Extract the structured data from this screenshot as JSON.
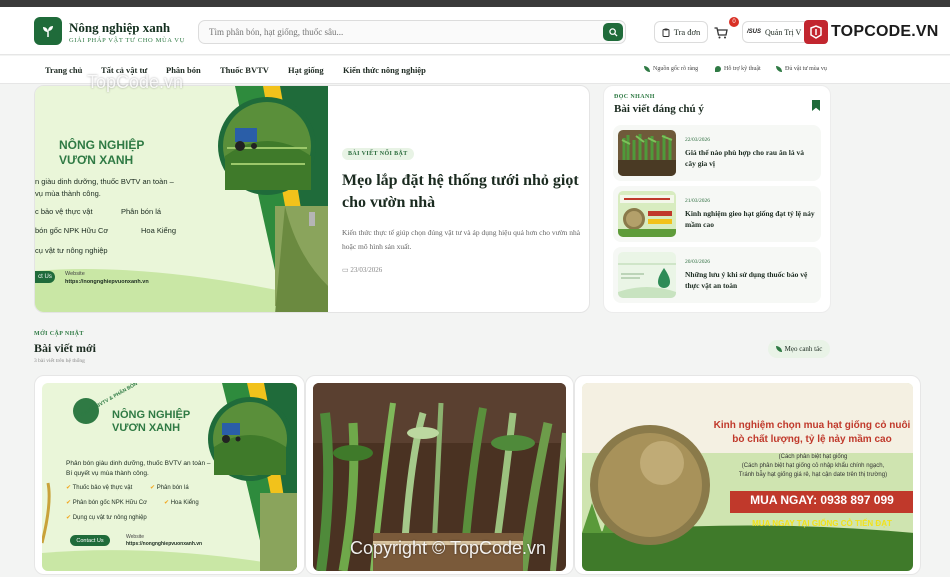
{
  "header": {
    "brand_name": "Nông nghiệp xanh",
    "brand_tagline": "GIẢI PHÁP VẬT TƯ CHO MÙA VỤ",
    "search_placeholder": "Tìm phân bón, hạt giống, thuốc sâu...",
    "lookup_label": "Tra đơn",
    "cart_count": "0",
    "admin_label": "Quản Trị V",
    "admin_brand": "/SUS",
    "watermark_logo_text": "TOPCODE.VN"
  },
  "nav": {
    "items": [
      "Trang chủ",
      "Tất cả vật tư",
      "Phân bón",
      "Thuốc BVTV",
      "Hạt giống",
      "Kiến thức nông nghiệp"
    ],
    "badges": [
      "Nguồn gốc rõ ràng",
      "Hỗ trợ kỹ thuật",
      "Đủ vật tư mùa vụ"
    ]
  },
  "watermarks": {
    "top": "TopCode.vn",
    "bottom": "Copyright © TopCode.vn"
  },
  "featured": {
    "pill": "BÀI VIẾT NỔI BẬT",
    "title": "Mẹo lắp đặt hệ thống tưới nhỏ giọt cho vườn nhà",
    "description": "Kiến thức thực tế giúp chọn đúng vật tư và áp dụng hiệu quả hơn cho vườn nhà hoặc mô hình sản xuất.",
    "date": "23/03/2026",
    "image_banner": {
      "title_line1": "NÔNG NGHIỆP",
      "title_line2": "VƯƠN XANH",
      "tagline_line1": "n giàu dinh dưỡng, thuốc BVTV an toàn –",
      "tagline_line2": "vụ mùa thành công.",
      "features": [
        "c bảo vệ thực vật",
        "Phân bón lá",
        "bón gốc NPK Hữu Cơ",
        "Hoa Kiểng",
        "cụ vật tư nông nghiệp"
      ],
      "cta": "ct Us",
      "website_label": "Website",
      "website_url": "https://nongnghiepvuonxanh.vn"
    }
  },
  "sidebar": {
    "kicker": "ĐỌC NHANH",
    "title": "Bài viết đáng chú ý",
    "posts": [
      {
        "date": "22/03/2026",
        "title": "Giá thể nào phù hợp cho rau ăn lá và cây gia vị"
      },
      {
        "date": "21/03/2026",
        "title": "Kinh nghiệm gieo hạt giống đạt tỷ lệ nảy mầm cao"
      },
      {
        "date": "20/03/2026",
        "title": "Những lưu ý khi sử dụng thuốc bảo vệ thực vật an toàn"
      }
    ]
  },
  "latest": {
    "kicker": "MỚI CẬP NHẬT",
    "title": "Bài viết mới",
    "subtitle": "3 bài viết trên hệ thống",
    "chip": "Mẹo canh tác",
    "card1": {
      "title_line1": "NÔNG NGHIỆP",
      "title_line2": "VƯƠN XANH",
      "arc_text": "THUỐC BVTV & PHÂN BÓN",
      "tagline_line1": "Phân bón giàu dinh dưỡng, thuốc BVTV an toàn –",
      "tagline_line2": "Bí quyết vụ mùa thành công.",
      "features": [
        "Thuốc bảo vệ thực vật",
        "Phân bón lá",
        "Phân bón gốc NPK Hữu Cơ",
        "Hoa Kiểng",
        "Dụng cụ vật tư nông nghiệp"
      ],
      "cta": "Contact Us",
      "website_label": "Website",
      "website_url": "https://nongnghiepvuonxanh.vn"
    },
    "card3": {
      "headline_line1": "Kinh nghiệm chọn mua hạt giống cỏ nuôi",
      "headline_line2": "bò chất lượng, tỷ lệ nảy mầm cao",
      "sub_line1": "(Cách phân biệt hạt giống",
      "sub_line2": "(Cách phân biệt hạt giống cỏ nhập khẩu chính ngạch,",
      "sub_line3": "Tránh bẫy hạt giống giá rẻ, hạt cận date trên thị trường)",
      "phone": "MUA NGAY: 0938 897 099",
      "bottom": "MUA NGAY TẠI GIỐNG CỎ TIẾN ĐẠT"
    }
  },
  "colors": {
    "brand": "#1f6b3a",
    "accent": "#2f7a44",
    "badge": "#d93025",
    "topcode_red": "#c2262f"
  }
}
